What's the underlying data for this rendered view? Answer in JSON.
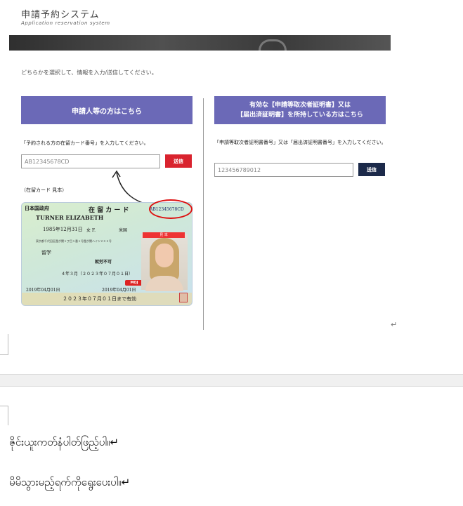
{
  "header": {
    "title": "申請予約システム",
    "subtitle": "Application reservation system"
  },
  "instruction": "どちらかを選択して、情報を入力/送信してください。",
  "left_panel": {
    "heading": "申請人等の方はこちら",
    "prompt": "「予約される方の在留カード番号」を入力してください。",
    "input_placeholder": "AB12345678CD",
    "submit_label": "送信",
    "sample_label": "（在留カード 見本）"
  },
  "right_panel": {
    "heading_line1": "有効な【申請等取次者証明書】又は",
    "heading_line2": "【届出済証明書】を所持している方はこちら",
    "prompt": "「申請等取次者証明書番号」又は「届出済証明書番号」を入力してください。",
    "input_placeholder": "123456789012",
    "submit_label": "送信"
  },
  "residence_card": {
    "issuer": "日本国政府",
    "title": "在 留 カ ー ド",
    "number": "AB12345678CD",
    "name": "TURNER ELIZABETH",
    "birth": "1985年12月31日",
    "sex": "女 F.",
    "nationality": "米国",
    "address": "東京都千代田区霞が関１丁目１番１号霞が関ハイツ２０２号",
    "status": "留学",
    "period": "４年３月（２０２３年０７月０１日）",
    "permission_date": "2019年04月01日",
    "issue_date": "2019年04月01日",
    "work_restriction": "就労不可",
    "validity": "２０２３年０７月０１日まで有効",
    "sample_tag": "見 本",
    "moj": "MOJ"
  },
  "document_text": {
    "return_mark": "↵",
    "line1": "ဇိုင်းယူးကတ်နံပါတ်ဖြည့်ပါ။↵",
    "line2": "မိမိသွားမည့်ရက်ကိုရွေးပေးပါ။↵"
  },
  "colors": {
    "panel_header": "#6b69b7",
    "left_submit": "#d9232e",
    "right_submit": "#1c2a4a"
  }
}
